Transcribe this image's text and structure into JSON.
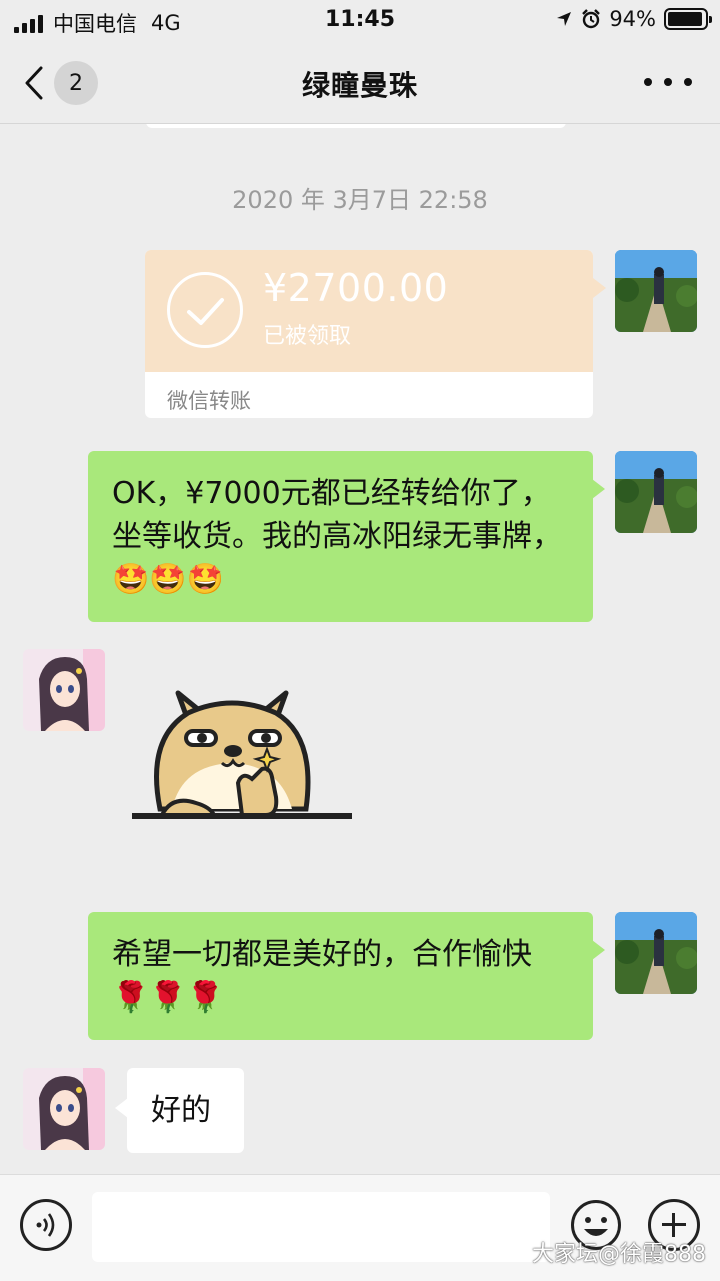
{
  "status_bar": {
    "carrier": "中国电信",
    "network": "4G",
    "time": "11:45",
    "battery_text": "94%",
    "battery_level": 0.94
  },
  "nav": {
    "unread_count": "2",
    "title": "绿瞳曼珠"
  },
  "chat": {
    "timestamp": "2020 年 3月7日 22:58",
    "transfer": {
      "amount": "¥2700.00",
      "status": "已被领取",
      "label": "微信转账",
      "color": "#f8e2c8"
    },
    "messages": [
      {
        "from": "self",
        "text": "OK，¥7000元都已经转给你了，坐等收货。我的高冰阳绿无事牌，🤩🤩🤩"
      },
      {
        "from": "other",
        "type": "sticker",
        "icon": "shiba-dog-sticker"
      },
      {
        "from": "self",
        "text": "希望一切都是美好的，合作愉快🌹🌹🌹"
      },
      {
        "from": "other",
        "text": "好的"
      }
    ]
  },
  "input_bar": {
    "voice_icon": "voice-icon",
    "emoji_icon": "emoji-icon",
    "plus_icon": "plus-icon"
  },
  "watermark": "大家坛@徐霞888",
  "colors": {
    "self_bubble": "#a9e87b",
    "other_bubble": "#ffffff",
    "background": "#ededed"
  }
}
